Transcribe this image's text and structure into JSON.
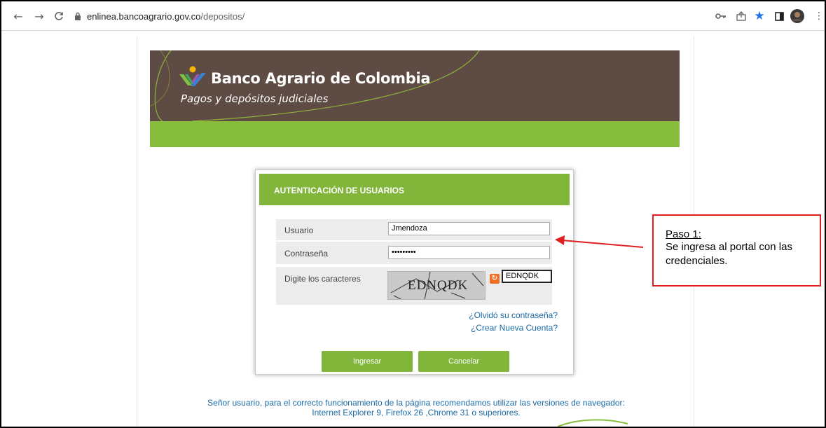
{
  "browser": {
    "url_host": "enlinea.bancoagrario.gov.co",
    "url_path": "/depositos/"
  },
  "banner": {
    "bank_name": "Banco Agrario de Colombia",
    "subtitle": "Pagos y depósitos judiciales"
  },
  "login": {
    "title": "AUTENTICACIÓN DE USUARIOS",
    "user_label": "Usuario",
    "user_value": "Jmendoza",
    "password_label": "Contraseña",
    "password_value": "•••••••••",
    "captcha_label": "Digite los caracteres",
    "captcha_text": "EDNQDK",
    "captcha_value": "EDNQDK",
    "forgot_link": "¿Olvidó su contraseña?",
    "new_account_link": "¿Crear Nueva Cuenta?",
    "submit_button": "Ingresar",
    "cancel_button": "Cancelar"
  },
  "notice": {
    "line1": "Señor usuario, para el correcto funcionamiento de la página recomendamos utilizar las versiones de navegador:",
    "line2": "Internet Explorer 9, Firefox 26 ,Chrome 31 o superiores."
  },
  "callout": {
    "title": "Paso 1:",
    "text": "Se ingresa al portal con las credenciales."
  },
  "colors": {
    "banner_brown": "#5e4b43",
    "brand_green": "#86bd3c",
    "link_blue": "#1a6aa5",
    "callout_red": "#e01f1f"
  },
  "icons": [
    "back-icon",
    "forward-icon",
    "reload-icon",
    "lock-icon",
    "key-icon",
    "share-icon",
    "star-icon",
    "sidepanel-icon",
    "profile-avatar",
    "menu-icon",
    "refresh-captcha-icon"
  ]
}
